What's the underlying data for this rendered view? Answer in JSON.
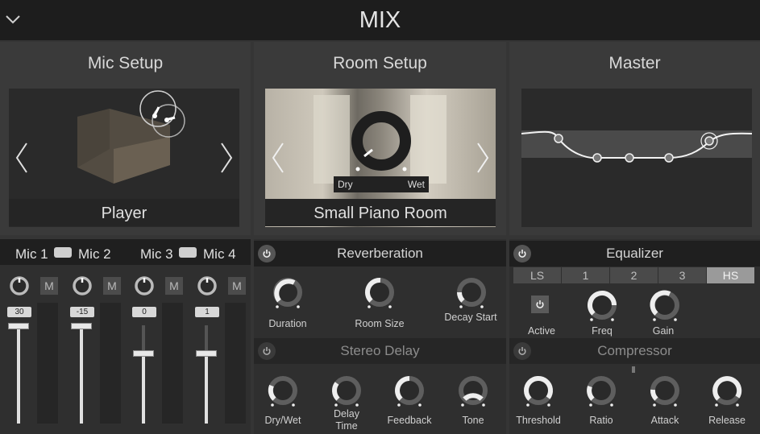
{
  "header": {
    "title": "MIX"
  },
  "panels": {
    "mic_setup": {
      "title": "Mic Setup",
      "caption": "Player"
    },
    "room_setup": {
      "title": "Room Setup",
      "caption": "Small Piano Room",
      "dry_label": "Dry",
      "wet_label": "Wet"
    },
    "master": {
      "title": "Master"
    }
  },
  "mics": {
    "labels": [
      "Mic 1",
      "Mic 2",
      "Mic 3",
      "Mic 4"
    ],
    "values": [
      "30",
      "-15",
      "0",
      "1"
    ],
    "mute_label": "M"
  },
  "reverb": {
    "title": "Reverberation",
    "knobs": [
      "Duration",
      "Room Size",
      "Decay Start"
    ]
  },
  "delay": {
    "title": "Stereo Delay",
    "knobs": [
      "Dry/Wet",
      "Delay Time",
      "Feedback",
      "Tone"
    ]
  },
  "eq": {
    "title": "Equalizer",
    "tabs": [
      "LS",
      "1",
      "2",
      "3",
      "HS"
    ],
    "selected_tab": "HS",
    "knobs": [
      "Active",
      "Freq",
      "Gain"
    ]
  },
  "comp": {
    "title": "Compressor",
    "knobs": [
      "Threshold",
      "Ratio",
      "Attack",
      "Release"
    ]
  },
  "icons": {
    "collapse": "chevron-down-icon",
    "power": "power-icon",
    "link": "link-icon",
    "prev": "chevron-left-icon",
    "next": "chevron-right-icon"
  }
}
